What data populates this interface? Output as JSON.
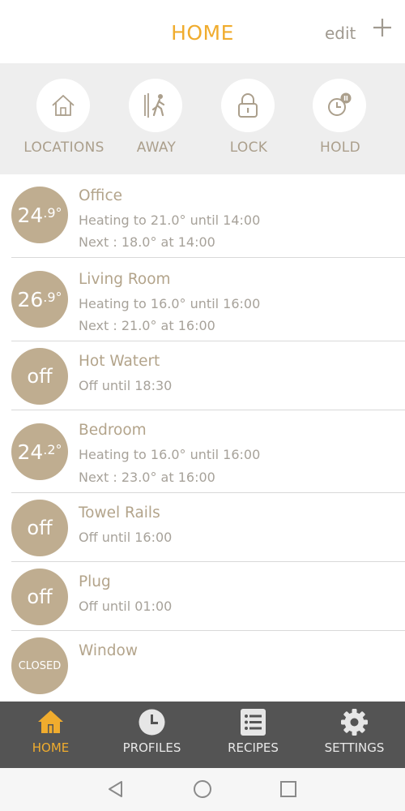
{
  "header": {
    "title": "HOME",
    "edit_label": "edit",
    "add_icon": "plus-icon"
  },
  "quick_actions": [
    {
      "label": "LOCATIONS",
      "icon": "house-icon"
    },
    {
      "label": "AWAY",
      "icon": "walking-person-icon"
    },
    {
      "label": "LOCK",
      "icon": "padlock-icon"
    },
    {
      "label": "HOLD",
      "icon": "clock-pause-icon"
    }
  ],
  "zones": [
    {
      "badge_main": "24",
      "badge_sup": ".9°",
      "name": "Office",
      "line1": "Heating to 21.0° until 14:00",
      "line2": "Next : 18.0° at 14:00"
    },
    {
      "badge_main": "26",
      "badge_sup": ".9°",
      "name": "Living Room",
      "line1": "Heating to 16.0° until 16:00",
      "line2": "Next : 21.0° at 16:00"
    },
    {
      "badge": "off",
      "name": "Hot Watert",
      "line1": "Off until 18:30"
    },
    {
      "badge_main": "24",
      "badge_sup": ".2°",
      "name": "Bedroom",
      "line1": "Heating to 16.0° until 16:00",
      "line2": "Next : 23.0° at 16:00"
    },
    {
      "badge": "off",
      "name": "Towel Rails",
      "line1": "Off until 16:00"
    },
    {
      "badge": "off",
      "name": "Plug",
      "line1": "Off until 01:00"
    },
    {
      "badge": "CLOSED",
      "name": "Window"
    }
  ],
  "tabs": [
    {
      "label": "HOME",
      "icon": "house-icon",
      "active": true
    },
    {
      "label": "PROFILES",
      "icon": "clock-icon"
    },
    {
      "label": "RECIPES",
      "icon": "list-icon"
    },
    {
      "label": "SETTINGS",
      "icon": "gear-icon"
    }
  ],
  "system_nav": {
    "back": "back-triangle-icon",
    "home": "home-circle-icon",
    "recents": "recents-square-icon"
  },
  "colors": {
    "accent": "#f0ac2e",
    "badge": "#bfad90",
    "tabbar": "#545454",
    "quickbar": "#eeeeee"
  }
}
